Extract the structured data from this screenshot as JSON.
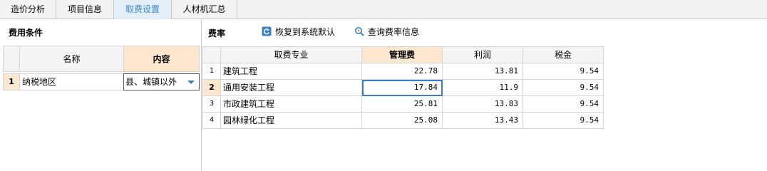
{
  "tabs": [
    {
      "label": "造价分析"
    },
    {
      "label": "项目信息"
    },
    {
      "label": "取费设置"
    },
    {
      "label": "人材机汇总"
    }
  ],
  "left_panel": {
    "title": "费用条件",
    "headers": {
      "name": "名称",
      "content": "内容"
    },
    "rows": [
      {
        "index": "1",
        "name": "纳税地区",
        "content": "县、城镇以外"
      }
    ]
  },
  "right_panel": {
    "title": "费率",
    "restore_default_label": "恢复到系统默认",
    "query_rate_label": "查询费率信息",
    "headers": {
      "category": "取费专业",
      "management": "管理费",
      "profit": "利润",
      "tax": "税金"
    },
    "rows": [
      {
        "index": "1",
        "category": "建筑工程",
        "management": "22.78",
        "profit": "13.81",
        "tax": "9.54"
      },
      {
        "index": "2",
        "category": "通用安装工程",
        "management": "17.84",
        "profit": "11.9",
        "tax": "9.54"
      },
      {
        "index": "3",
        "category": "市政建筑工程",
        "management": "25.81",
        "profit": "13.83",
        "tax": "9.54"
      },
      {
        "index": "4",
        "category": "园林绿化工程",
        "management": "25.08",
        "profit": "13.43",
        "tax": "9.54"
      }
    ]
  },
  "colors": {
    "accent": "#3a8bd0",
    "highlight": "#fde8cf"
  },
  "icons": {
    "restore": "refresh-icon",
    "query": "search-icon",
    "dropdown": "chevron-down-icon"
  }
}
